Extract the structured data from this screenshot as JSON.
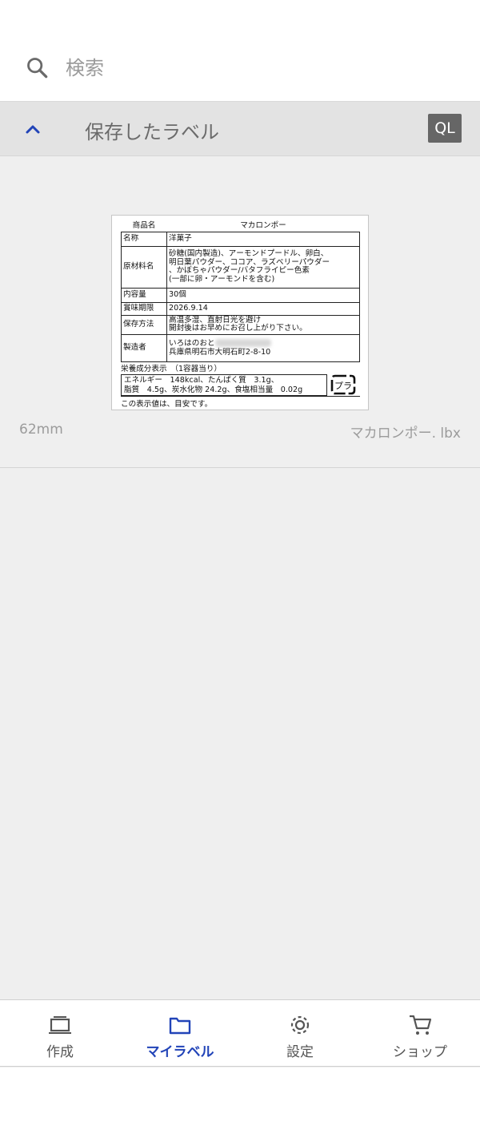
{
  "search": {
    "placeholder": "検索"
  },
  "section": {
    "title": "保存したラベル",
    "badge": "QL"
  },
  "label_card": {
    "preview": {
      "header_key": "商品名",
      "header_value": "マカロンポー",
      "rows": [
        {
          "key": "名称",
          "value": "洋菓子"
        },
        {
          "key": "原材料名",
          "lines": [
            "砂糖(国内製造)、アーモンドプードル、卵白、",
            "明日葉パウダー、ココア、ラズベリーパウダー",
            "、かぼちゃパウダー/バタフライピー色素",
            "(一部に卵・アーモンドを含む)"
          ]
        },
        {
          "key": "内容量",
          "value": "30個"
        },
        {
          "key": "賞味期限",
          "value": "2026.9.14"
        },
        {
          "key": "保存方法",
          "lines": [
            "高温多湿、直射日光を避け",
            "開封後はお早めにお召し上がり下さい。"
          ]
        },
        {
          "key": "製造者",
          "lines": [
            "いろはのおと",
            "兵庫県明石市大明石町2-8-10"
          ]
        }
      ],
      "nutrition_title": "栄養成分表示　（1容器当り）",
      "nutrition_lines": [
        "エネルギー　148kcal、たんぱく質　3.1g、",
        "脂質　4.5g、炭水化物 24.2g、食塩相当量　0.02g"
      ],
      "recycle_mark": "プラ",
      "footer": "この表示値は、目安です。"
    },
    "size": "62mm",
    "filename": "マカロンポー. lbx"
  },
  "bottom_nav": [
    {
      "label": "作成",
      "icon": "create-icon",
      "active": false
    },
    {
      "label": "マイラベル",
      "icon": "folder-icon",
      "active": true
    },
    {
      "label": "設定",
      "icon": "gear-icon",
      "active": false
    },
    {
      "label": "ショップ",
      "icon": "cart-icon",
      "active": false
    }
  ],
  "colors": {
    "accent": "#2244b8",
    "background": "#efefef",
    "header": "#e3e3e3",
    "badge": "#666666"
  }
}
